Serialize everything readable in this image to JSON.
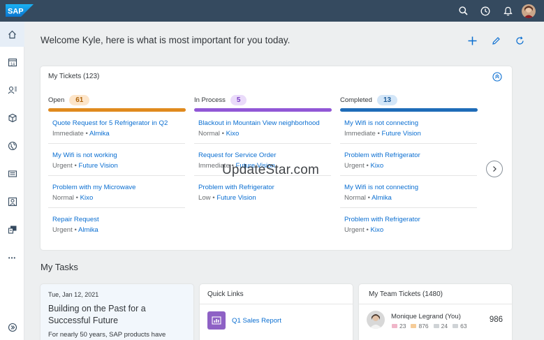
{
  "shell": {
    "logo_text": "SAP",
    "icons": [
      "search-icon",
      "history-icon",
      "notifications-icon",
      "user-avatar"
    ]
  },
  "sidenav": {
    "items": [
      "home-icon",
      "calendar-icon",
      "contacts-icon",
      "product-icon",
      "globe-icon",
      "list-icon",
      "customer-icon",
      "monitor-icon",
      "more-icon",
      "expand-icon"
    ],
    "calendar_number": "14",
    "more_glyph": "•••"
  },
  "header": {
    "welcome": "Welcome Kyle, here is what is most important for you today."
  },
  "tickets": {
    "title": "My Tickets (123)",
    "columns": [
      {
        "label": "Open",
        "count": "61",
        "items": [
          {
            "title": "Quote Request for 5 Refrigerator in Q2",
            "priority": "Immediate",
            "org": "Almika"
          },
          {
            "title": "My Wifi is not working",
            "priority": "Urgent",
            "org": "Future Vision"
          },
          {
            "title": "Problem with my Microwave",
            "priority": "Normal",
            "org": "Kixo"
          },
          {
            "title": "Repair Request",
            "priority": "Urgent",
            "org": "Almika"
          }
        ]
      },
      {
        "label": "In Process",
        "count": "5",
        "items": [
          {
            "title": "Blackout in Mountain View neighborhood",
            "priority": "Normal",
            "org": "Kixo"
          },
          {
            "title": "Request for Service Order",
            "priority": "Immediate",
            "org": "Future Vision"
          },
          {
            "title": "Problem with Refrigerator",
            "priority": "Low",
            "org": "Future Vision"
          }
        ]
      },
      {
        "label": "Completed",
        "count": "13",
        "items": [
          {
            "title": "My Wifi is not connecting",
            "priority": "Immediate",
            "org": "Future Vision"
          },
          {
            "title": "Problem with Refrigerator",
            "priority": "Urgent",
            "org": "Kixo"
          },
          {
            "title": "My Wifi is not connecting",
            "priority": "Normal",
            "org": "Almika"
          },
          {
            "title": "Problem with Refrigerator",
            "priority": "Urgent",
            "org": "Kixo"
          }
        ]
      }
    ],
    "watermark": "UpdateStar.com"
  },
  "tasks": {
    "title": "My Tasks",
    "news": {
      "date": "Tue, Jan 12,  2021",
      "title": "Building on the Past for a Successful Future",
      "text": "For nearly 50 years, SAP products have"
    },
    "quick_links": {
      "title": "Quick Links",
      "link": "Q1 Sales Report"
    },
    "team": {
      "title": "My Team Tickets (1480)",
      "member": {
        "name": "Monique Legrand (You)",
        "stats": [
          "23",
          "876",
          "24",
          "63"
        ],
        "total": "986"
      }
    }
  },
  "colors": {
    "shell": "#354a5f",
    "open": "#e08a1e",
    "open_badge_bg": "#fde5c9",
    "open_badge_fg": "#b0650c",
    "inprocess": "#9157d6",
    "inprocess_badge_bg": "#eadbfa",
    "inprocess_badge_fg": "#7a3fc4",
    "completed": "#1f6cb8",
    "completed_badge_bg": "#d3e6f8",
    "completed_badge_fg": "#1a5a99",
    "link": "#0a6ed1"
  }
}
